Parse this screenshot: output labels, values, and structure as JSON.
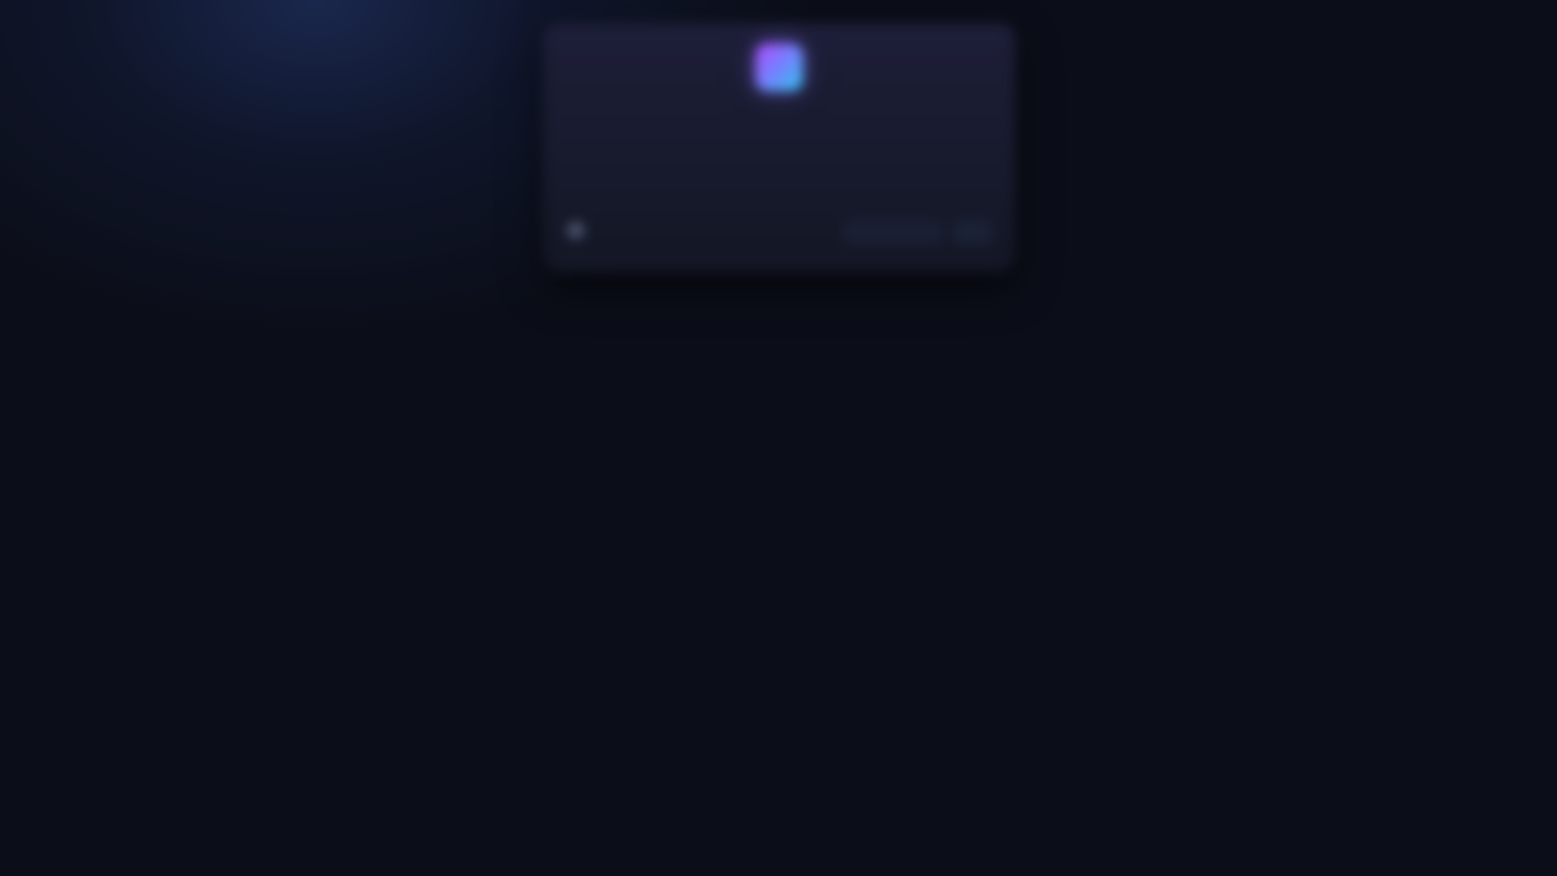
{
  "app": {
    "title": "",
    "subtitle": ""
  },
  "status": {
    "label": ""
  },
  "counter": {
    "label": "",
    "value_a": "",
    "value_b": ""
  },
  "actions": {
    "primary_label": "",
    "secondary_label": ""
  },
  "colors": {
    "background": "#0b0e18",
    "card": "#1b1d33",
    "logo_gradient_start": "#b14cff",
    "logo_gradient_end": "#2fc6f0",
    "title_text": "#e7e8f2"
  },
  "icons": {
    "logo": "app-logo-gradient-square",
    "status": "status-dot"
  }
}
